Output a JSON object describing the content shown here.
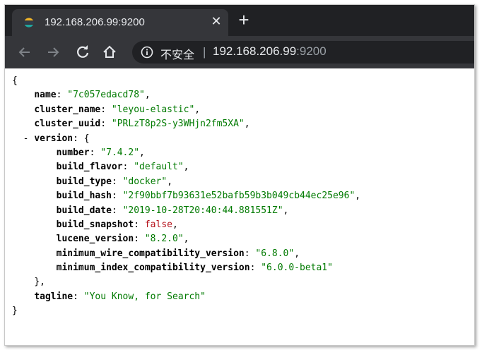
{
  "browser": {
    "tab": {
      "title": "192.168.206.99:9200",
      "favicon": "elastic-logo-icon",
      "close_glyph": "✕"
    },
    "new_tab_glyph": "+",
    "toolbar": {
      "back_icon": "back-arrow-icon",
      "forward_icon": "forward-arrow-icon",
      "reload_icon": "reload-icon",
      "home_icon": "home-icon"
    },
    "omnibox": {
      "security_label": "不安全",
      "divider": "|",
      "host": "192.168.206.99",
      "port": ":9200"
    }
  },
  "json_view": {
    "open_brace": "{",
    "close_brace": "}",
    "name_key": "name",
    "name_value": "\"7c057edacd78\"",
    "cluster_name_key": "cluster_name",
    "cluster_name_value": "\"leyou-elastic\"",
    "cluster_uuid_key": "cluster_uuid",
    "cluster_uuid_value": "\"PRLzT8p2S-y3WHjn2fm5XA\"",
    "version_toggle": "-",
    "version_key": "version",
    "version_open": "{",
    "version_close": "},",
    "version": {
      "number_key": "number",
      "number_value": "\"7.4.2\"",
      "build_flavor_key": "build_flavor",
      "build_flavor_value": "\"default\"",
      "build_type_key": "build_type",
      "build_type_value": "\"docker\"",
      "build_hash_key": "build_hash",
      "build_hash_value": "\"2f90bbf7b93631e52bafb59b3b049cb44ec25e96\"",
      "build_date_key": "build_date",
      "build_date_value": "\"2019-10-28T20:40:44.881551Z\"",
      "build_snapshot_key": "build_snapshot",
      "build_snapshot_value": "false",
      "lucene_version_key": "lucene_version",
      "lucene_version_value": "\"8.2.0\"",
      "min_wire_key": "minimum_wire_compatibility_version",
      "min_wire_value": "\"6.8.0\"",
      "min_index_key": "minimum_index_compatibility_version",
      "min_index_value": "\"6.0.0-beta1\""
    },
    "tagline_key": "tagline",
    "tagline_value": "\"You Know, for Search\""
  },
  "colors": {
    "string": "#007a00",
    "boolean": "#b5121b",
    "chrome_dark": "#202124",
    "chrome_toolbar": "#35363a"
  }
}
